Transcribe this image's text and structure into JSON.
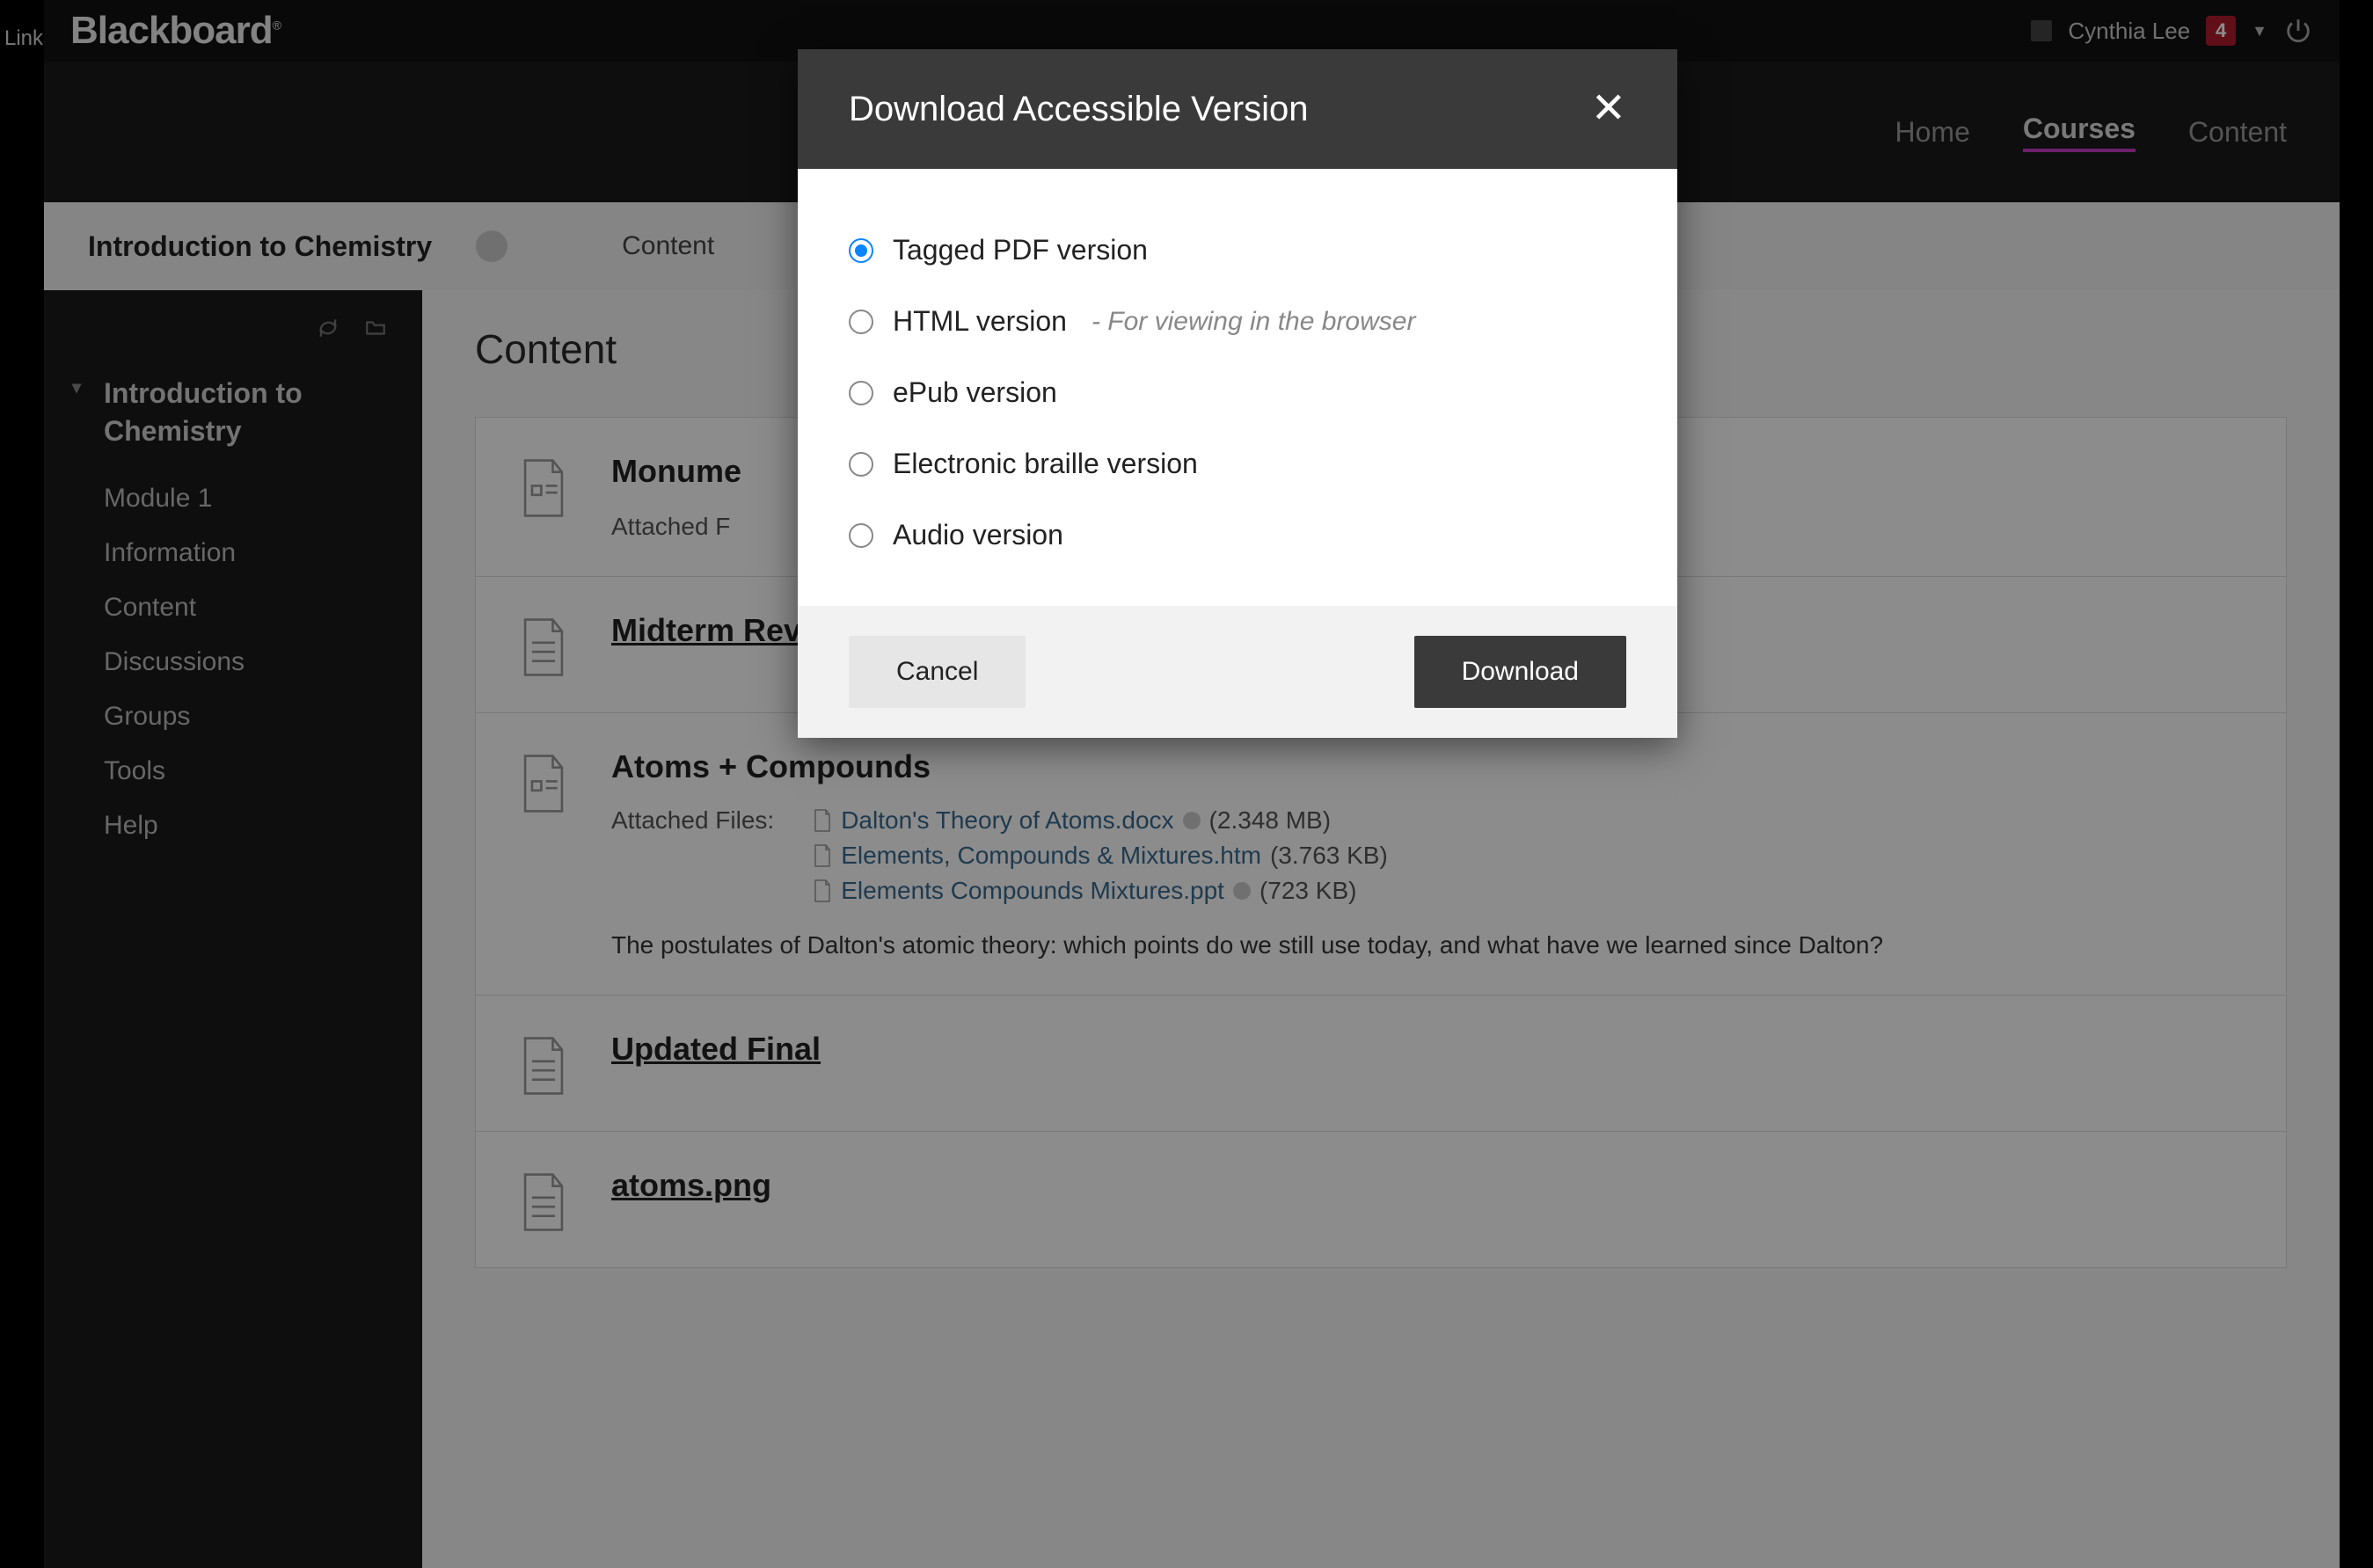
{
  "links_label": "Links",
  "logo": "Blackboard",
  "user": {
    "name": "Cynthia Lee",
    "badge": "4"
  },
  "nav": {
    "items": [
      {
        "label": "Home",
        "active": false
      },
      {
        "label": "Courses",
        "active": true
      },
      {
        "label": "Content",
        "active": false
      }
    ]
  },
  "crumb": {
    "course": "Introduction to Chemistry",
    "section": "Content"
  },
  "sidebar": {
    "heading": "Introduction to Chemistry",
    "items": [
      {
        "label": "Module 1"
      },
      {
        "label": "Information"
      },
      {
        "label": "Content"
      },
      {
        "label": "Discussions"
      },
      {
        "label": "Groups"
      },
      {
        "label": "Tools"
      },
      {
        "label": "Help"
      }
    ]
  },
  "page_title": "Content",
  "cards": [
    {
      "title": "Monume",
      "attached_label": "Attached F"
    },
    {
      "title": "Midterm Review",
      "link": true
    },
    {
      "title": "Atoms + Compounds",
      "attached_label": "Attached Files:",
      "files": [
        {
          "name": "Dalton's Theory of Atoms.docx",
          "size": "(2.348 MB)"
        },
        {
          "name": "Elements, Compounds & Mixtures.htm",
          "size": "(3.763 KB)"
        },
        {
          "name": "Elements Compounds Mixtures.ppt",
          "size": "(723 KB)"
        }
      ],
      "desc": "The postulates of Dalton's atomic theory: which points do we still use today, and what have we learned since Dalton?"
    },
    {
      "title": "Updated Final",
      "link": true
    },
    {
      "title": "atoms.png",
      "link": true
    }
  ],
  "modal": {
    "title": "Download Accessible Version",
    "options": [
      {
        "label": "Tagged PDF version",
        "checked": true
      },
      {
        "label": "HTML version",
        "hint": "- For viewing in the browser"
      },
      {
        "label": "ePub version"
      },
      {
        "label": "Electronic braille version"
      },
      {
        "label": "Audio version"
      }
    ],
    "cancel": "Cancel",
    "download": "Download"
  }
}
